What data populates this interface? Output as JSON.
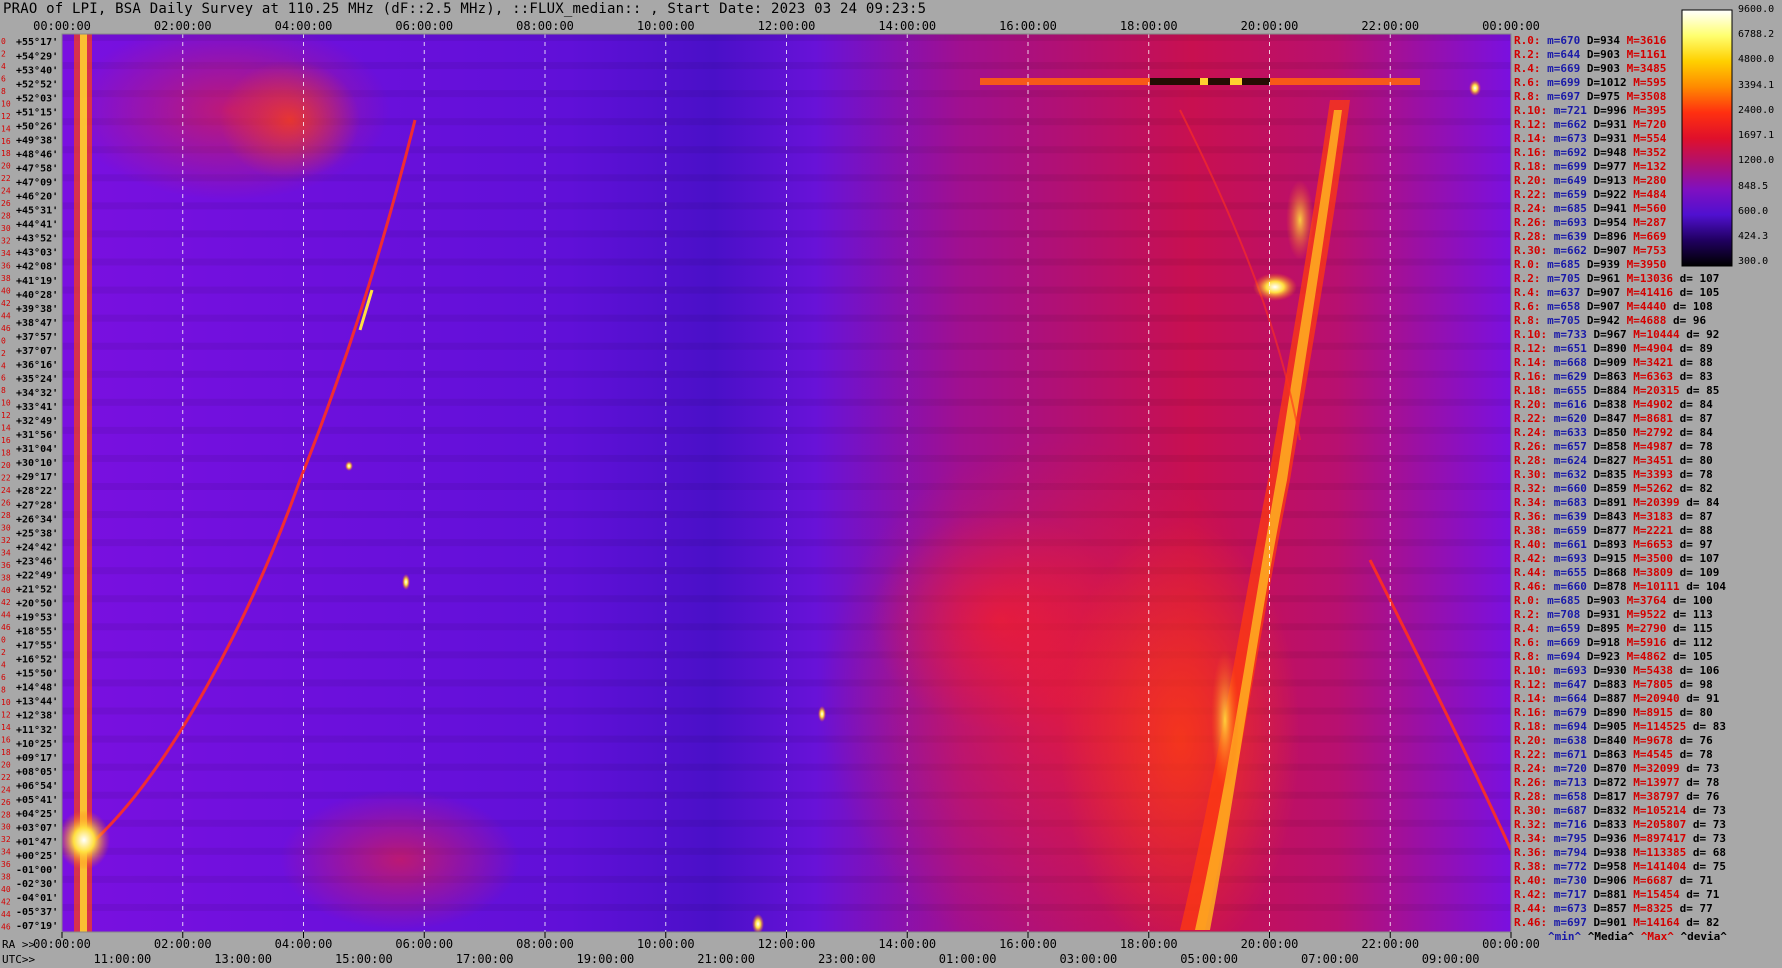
{
  "title": "PRAO of LPI, BSA Daily Survey at 110.25 MHz (dF::2.5 MHz), ::FLUX_median:: , Start Date: 2023 03 24 09:23:5",
  "axes": {
    "top_ticks": [
      "00:00:00",
      "02:00:00",
      "04:00:00",
      "06:00:00",
      "08:00:00",
      "10:00:00",
      "12:00:00",
      "14:00:00",
      "16:00:00",
      "18:00:00",
      "20:00:00",
      "22:00:00",
      "00:00:00"
    ],
    "bottom_ra_prefix": "RA >>",
    "bottom_ra_ticks": [
      "00:00:00",
      "02:00:00",
      "04:00:00",
      "06:00:00",
      "08:00:00",
      "10:00:00",
      "12:00:00",
      "14:00:00",
      "16:00:00",
      "18:00:00",
      "20:00:00",
      "22:00:00",
      "00:00:00"
    ],
    "utc_prefix": "UTC>>",
    "utc_ticks": [
      "11:00:00",
      "13:00:00",
      "15:00:00",
      "17:00:00",
      "19:00:00",
      "21:00:00",
      "23:00:00",
      "01:00:00",
      "03:00:00",
      "05:00:00",
      "07:00:00",
      "09:00:00"
    ]
  },
  "declinations": [
    "+55°17'",
    "+54°29'",
    "+53°40'",
    "+52°52'",
    "+52°03'",
    "+51°15'",
    "+50°26'",
    "+49°38'",
    "+48°46'",
    "+47°58'",
    "+47°09'",
    "+46°20'",
    "+45°31'",
    "+44°41'",
    "+43°52'",
    "+43°03'",
    "+42°08'",
    "+41°19'",
    "+40°28'",
    "+39°38'",
    "+38°47'",
    "+37°57'",
    "+37°07'",
    "+36°16'",
    "+35°24'",
    "+34°32'",
    "+33°41'",
    "+32°49'",
    "+31°56'",
    "+31°04'",
    "+30°10'",
    "+29°17'",
    "+28°22'",
    "+27°28'",
    "+26°34'",
    "+25°38'",
    "+24°42'",
    "+23°46'",
    "+22°49'",
    "+21°52'",
    "+20°50'",
    "+19°53'",
    "+18°55'",
    "+17°55'",
    "+16°52'",
    "+15°50'",
    "+14°48'",
    "+13°44'",
    "+12°38'",
    "+11°32'",
    "+10°25'",
    "+09°17'",
    "+08°05'",
    "+06°54'",
    "+05°41'",
    "+04°25'",
    "+03°07'",
    "+01°47'",
    "+00°25'",
    "-01°00'",
    "-02°30'",
    "-04°01'",
    "-05°37'",
    "-07°19'"
  ],
  "beam_numbers": [
    "0",
    "2",
    "4",
    "6",
    "8",
    "10",
    "12",
    "14",
    "16",
    "18",
    "20",
    "22",
    "24",
    "26",
    "28",
    "30",
    "32",
    "34",
    "36",
    "38",
    "40",
    "42",
    "44",
    "46",
    "0",
    "2",
    "4",
    "6",
    "8",
    "10",
    "12",
    "14",
    "16",
    "18",
    "20",
    "22",
    "24",
    "26",
    "28",
    "30",
    "32",
    "34",
    "36",
    "38",
    "40",
    "42",
    "44",
    "46",
    "0",
    "2",
    "4",
    "6",
    "8",
    "10",
    "12",
    "14",
    "16",
    "18",
    "20",
    "22",
    "24",
    "26",
    "28",
    "30",
    "32",
    "34",
    "36",
    "38",
    "40",
    "42",
    "44",
    "46"
  ],
  "colorbar": {
    "labels": [
      "9600.0",
      "6788.2",
      "4800.0",
      "3394.1",
      "2400.0",
      "1697.1",
      "1200.0",
      "848.5",
      "600.0",
      "424.3",
      "300.0"
    ],
    "stops": [
      "#ffffff",
      "#ffff70",
      "#ffd000",
      "#ff8a00",
      "#ff3010",
      "#e0102a",
      "#b01070",
      "#8010c0",
      "#5010d0",
      "#200060",
      "#000000"
    ]
  },
  "stats": [
    {
      "label": "R.0:",
      "min": "m=670",
      "med": "D=934",
      "max": "M=3616",
      "dev": ""
    },
    {
      "label": "R.2:",
      "min": "m=644",
      "med": "D=903",
      "max": "M=1161",
      "dev": ""
    },
    {
      "label": "R.4:",
      "min": "m=669",
      "med": "D=903",
      "max": "M=3485",
      "dev": ""
    },
    {
      "label": "R.6:",
      "min": "m=699",
      "med": "D=1012",
      "max": "M=595",
      "dev": ""
    },
    {
      "label": "R.8:",
      "min": "m=697",
      "med": "D=975",
      "max": "M=3508",
      "dev": ""
    },
    {
      "label": "R.10:",
      "min": "m=721",
      "med": "D=996",
      "max": "M=395",
      "dev": ""
    },
    {
      "label": "R.12:",
      "min": "m=662",
      "med": "D=931",
      "max": "M=720",
      "dev": ""
    },
    {
      "label": "R.14:",
      "min": "m=673",
      "med": "D=931",
      "max": "M=554",
      "dev": ""
    },
    {
      "label": "R.16:",
      "min": "m=692",
      "med": "D=948",
      "max": "M=352",
      "dev": ""
    },
    {
      "label": "R.18:",
      "min": "m=699",
      "med": "D=977",
      "max": "M=132",
      "dev": ""
    },
    {
      "label": "R.20:",
      "min": "m=649",
      "med": "D=913",
      "max": "M=280",
      "dev": ""
    },
    {
      "label": "R.22:",
      "min": "m=659",
      "med": "D=922",
      "max": "M=484",
      "dev": ""
    },
    {
      "label": "R.24:",
      "min": "m=685",
      "med": "D=941",
      "max": "M=560",
      "dev": ""
    },
    {
      "label": "R.26:",
      "min": "m=693",
      "med": "D=954",
      "max": "M=287",
      "dev": ""
    },
    {
      "label": "R.28:",
      "min": "m=639",
      "med": "D=896",
      "max": "M=669",
      "dev": ""
    },
    {
      "label": "R.30:",
      "min": "m=662",
      "med": "D=907",
      "max": "M=753",
      "dev": ""
    },
    {
      "label": "R.0:",
      "min": "m=685",
      "med": "D=939",
      "max": "M=3950",
      "dev": ""
    },
    {
      "label": "R.2:",
      "min": "m=705",
      "med": "D=961",
      "max": "M=13036",
      "dev": "d= 107"
    },
    {
      "label": "R.4:",
      "min": "m=637",
      "med": "D=907",
      "max": "M=41416",
      "dev": "d= 105"
    },
    {
      "label": "R.6:",
      "min": "m=658",
      "med": "D=907",
      "max": "M=4440",
      "dev": "d= 108"
    },
    {
      "label": "R.8:",
      "min": "m=705",
      "med": "D=942",
      "max": "M=4688",
      "dev": "d= 96"
    },
    {
      "label": "R.10:",
      "min": "m=733",
      "med": "D=967",
      "max": "M=10444",
      "dev": "d= 92"
    },
    {
      "label": "R.12:",
      "min": "m=651",
      "med": "D=890",
      "max": "M=4904",
      "dev": "d= 89"
    },
    {
      "label": "R.14:",
      "min": "m=668",
      "med": "D=909",
      "max": "M=3421",
      "dev": "d= 88"
    },
    {
      "label": "R.16:",
      "min": "m=629",
      "med": "D=863",
      "max": "M=6363",
      "dev": "d= 83"
    },
    {
      "label": "R.18:",
      "min": "m=655",
      "med": "D=884",
      "max": "M=20315",
      "dev": "d= 85"
    },
    {
      "label": "R.20:",
      "min": "m=616",
      "med": "D=838",
      "max": "M=4902",
      "dev": "d= 84"
    },
    {
      "label": "R.22:",
      "min": "m=620",
      "med": "D=847",
      "max": "M=8681",
      "dev": "d= 87"
    },
    {
      "label": "R.24:",
      "min": "m=633",
      "med": "D=850",
      "max": "M=2792",
      "dev": "d= 84"
    },
    {
      "label": "R.26:",
      "min": "m=657",
      "med": "D=858",
      "max": "M=4987",
      "dev": "d= 78"
    },
    {
      "label": "R.28:",
      "min": "m=624",
      "med": "D=827",
      "max": "M=3451",
      "dev": "d= 80"
    },
    {
      "label": "R.30:",
      "min": "m=632",
      "med": "D=835",
      "max": "M=3393",
      "dev": "d= 78"
    },
    {
      "label": "R.32:",
      "min": "m=660",
      "med": "D=859",
      "max": "M=5262",
      "dev": "d= 82"
    },
    {
      "label": "R.34:",
      "min": "m=683",
      "med": "D=891",
      "max": "M=20399",
      "dev": "d= 84"
    },
    {
      "label": "R.36:",
      "min": "m=639",
      "med": "D=843",
      "max": "M=3183",
      "dev": "d= 87"
    },
    {
      "label": "R.38:",
      "min": "m=659",
      "med": "D=877",
      "max": "M=2221",
      "dev": "d= 88"
    },
    {
      "label": "R.40:",
      "min": "m=661",
      "med": "D=893",
      "max": "M=6653",
      "dev": "d= 97"
    },
    {
      "label": "R.42:",
      "min": "m=693",
      "med": "D=915",
      "max": "M=3500",
      "dev": "d= 107"
    },
    {
      "label": "R.44:",
      "min": "m=655",
      "med": "D=868",
      "max": "M=3809",
      "dev": "d= 109"
    },
    {
      "label": "R.46:",
      "min": "m=660",
      "med": "D=878",
      "max": "M=10111",
      "dev": "d= 104"
    },
    {
      "label": "R.0:",
      "min": "m=685",
      "med": "D=903",
      "max": "M=3764",
      "dev": "d= 100"
    },
    {
      "label": "R.2:",
      "min": "m=708",
      "med": "D=931",
      "max": "M=9522",
      "dev": "d= 113"
    },
    {
      "label": "R.4:",
      "min": "m=659",
      "med": "D=895",
      "max": "M=2790",
      "dev": "d= 115"
    },
    {
      "label": "R.6:",
      "min": "m=669",
      "med": "D=918",
      "max": "M=5916",
      "dev": "d= 112"
    },
    {
      "label": "R.8:",
      "min": "m=694",
      "med": "D=923",
      "max": "M=4862",
      "dev": "d= 105"
    },
    {
      "label": "R.10:",
      "min": "m=693",
      "med": "D=930",
      "max": "M=5438",
      "dev": "d= 106"
    },
    {
      "label": "R.12:",
      "min": "m=647",
      "med": "D=883",
      "max": "M=7805",
      "dev": "d= 98"
    },
    {
      "label": "R.14:",
      "min": "m=664",
      "med": "D=887",
      "max": "M=20940",
      "dev": "d= 91"
    },
    {
      "label": "R.16:",
      "min": "m=679",
      "med": "D=890",
      "max": "M=8915",
      "dev": "d= 80"
    },
    {
      "label": "R.18:",
      "min": "m=694",
      "med": "D=905",
      "max": "M=114525",
      "dev": "d= 83"
    },
    {
      "label": "R.20:",
      "min": "m=638",
      "med": "D=840",
      "max": "M=9678",
      "dev": "d= 76"
    },
    {
      "label": "R.22:",
      "min": "m=671",
      "med": "D=863",
      "max": "M=4545",
      "dev": "d= 78"
    },
    {
      "label": "R.24:",
      "min": "m=720",
      "med": "D=870",
      "max": "M=32099",
      "dev": "d= 73"
    },
    {
      "label": "R.26:",
      "min": "m=713",
      "med": "D=872",
      "max": "M=13977",
      "dev": "d= 78"
    },
    {
      "label": "R.28:",
      "min": "m=658",
      "med": "D=817",
      "max": "M=38797",
      "dev": "d= 76"
    },
    {
      "label": "R.30:",
      "min": "m=687",
      "med": "D=832",
      "max": "M=105214",
      "dev": "d= 73"
    },
    {
      "label": "R.32:",
      "min": "m=716",
      "med": "D=833",
      "max": "M=205807",
      "dev": "d= 73"
    },
    {
      "label": "R.34:",
      "min": "m=795",
      "med": "D=936",
      "max": "M=897417",
      "dev": "d= 73"
    },
    {
      "label": "R.36:",
      "min": "m=794",
      "med": "D=938",
      "max": "M=113385",
      "dev": "d= 68"
    },
    {
      "label": "R.38:",
      "min": "m=772",
      "med": "D=958",
      "max": "M=141404",
      "dev": "d= 75"
    },
    {
      "label": "R.40:",
      "min": "m=730",
      "med": "D=906",
      "max": "M=6687",
      "dev": "d= 71"
    },
    {
      "label": "R.42:",
      "min": "m=717",
      "med": "D=881",
      "max": "M=15454",
      "dev": "d= 71"
    },
    {
      "label": "R.44:",
      "min": "m=673",
      "med": "D=857",
      "max": "M=8325",
      "dev": "d= 77"
    },
    {
      "label": "R.46:",
      "min": "m=697",
      "med": "D=901",
      "max": "M=14164",
      "dev": "d= 82"
    }
  ],
  "stats_footer": {
    "min": "^min^",
    "med": "^Media^",
    "max": "^Max^",
    "dev": "^devia^"
  },
  "chart_data": {
    "type": "heatmap",
    "title": "PRAO of LPI, BSA Daily Survey at 110.25 MHz (dF::2.5 MHz), ::FLUX_median:: , Start Date: 2023 03 24 09:23:5",
    "x_axis": "RA (hours), 00:00:00 to 00:00:00",
    "y_axis": "Declination, +55°17' to -07°19'",
    "xlim": [
      0,
      24
    ],
    "ylim": [
      55.28,
      -7.32
    ],
    "color_scale": "log",
    "color_range": [
      300.0,
      9600.0
    ],
    "colorbar_ticks": [
      9600.0,
      6788.2,
      4800.0,
      3394.1,
      2400.0,
      1697.1,
      1200.0,
      848.5,
      600.0,
      424.3,
      300.0
    ],
    "grid": true
  }
}
